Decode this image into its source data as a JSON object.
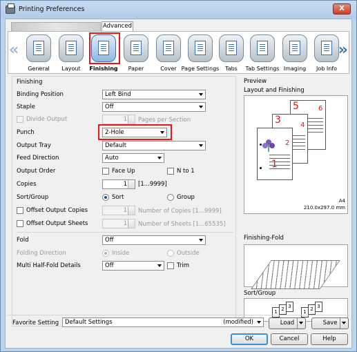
{
  "window": {
    "title": "Printing Preferences",
    "close_label": "X"
  },
  "tabs": {
    "advanced": "Advanced"
  },
  "categories": [
    {
      "id": "general",
      "label": "General"
    },
    {
      "id": "layout",
      "label": "Layout"
    },
    {
      "id": "finishing",
      "label": "Finishing"
    },
    {
      "id": "paper",
      "label": "Paper"
    },
    {
      "id": "cover",
      "label": "Cover"
    },
    {
      "id": "page_settings",
      "label": "Page Settings"
    },
    {
      "id": "tabs",
      "label": "Tabs"
    },
    {
      "id": "tab_settings",
      "label": "Tab Settings"
    },
    {
      "id": "imaging",
      "label": "Imaging"
    },
    {
      "id": "job_info",
      "label": "Job Info"
    }
  ],
  "finishing": {
    "group_title": "Finishing",
    "binding_position": {
      "label": "Binding Position",
      "value": "Left Bind"
    },
    "staple": {
      "label": "Staple",
      "value": "Off"
    },
    "divide_output": {
      "label": "Divide Output",
      "value": "1",
      "hint": "Pages per Section"
    },
    "punch": {
      "label": "Punch",
      "value": "2-Hole"
    },
    "output_tray": {
      "label": "Output Tray",
      "value": "Default"
    },
    "feed_direction": {
      "label": "Feed Direction",
      "value": "Auto"
    },
    "output_order": {
      "label": "Output Order",
      "face_up": "Face Up",
      "n_to_1": "N to 1"
    },
    "copies": {
      "label": "Copies",
      "value": "1",
      "range": "[1...9999]"
    },
    "sort_group": {
      "label": "Sort/Group",
      "sort": "Sort",
      "group": "Group"
    },
    "offset_copies": {
      "label": "Offset Output Copies",
      "value": "1",
      "hint": "Number of Copies [1...9999]"
    },
    "offset_sheets": {
      "label": "Offset Output Sheets",
      "value": "1",
      "hint": "Number of Sheets [1...65535]"
    },
    "fold": {
      "label": "Fold",
      "value": "Off"
    },
    "folding_direction": {
      "label": "Folding Direction",
      "inside": "Inside",
      "outside": "Outside"
    },
    "multi_half_fold": {
      "label": "Multi Half-Fold Details",
      "value": "Off",
      "trim": "Trim"
    }
  },
  "preview": {
    "title": "Preview",
    "layout_label": "Layout and Finishing",
    "paper_size": "A4",
    "paper_dims": "210.0x297.0 mm",
    "page_numbers": [
      "1",
      "2",
      "3",
      "4",
      "5",
      "6"
    ],
    "finishing_fold_label": "Finishing-Fold",
    "sort_group_label": "Sort/Group",
    "sort_cards": [
      "1",
      "2",
      "3"
    ]
  },
  "bottom": {
    "favorite_label": "Favorite Setting",
    "favorite_value": "Default Settings",
    "modified": "(modified)",
    "load": "Load",
    "save": "Save",
    "ok": "OK",
    "cancel": "Cancel",
    "help": "Help"
  },
  "colors": {
    "highlight": "#e01818",
    "accent": "#3a74b5"
  }
}
